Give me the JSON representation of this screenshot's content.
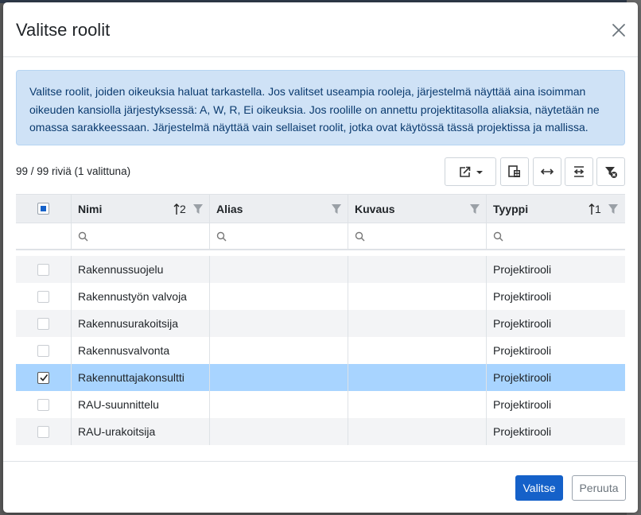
{
  "dialog": {
    "title": "Valitse roolit",
    "info_text": "Valitse roolit, joiden oikeuksia haluat tarkastella. Jos valitset useampia rooleja, järjestelmä näyttää aina isoimman oikeuden kansiolla järjestyksessä: A, W, R, Ei oikeuksia. Jos roolille on annettu projektitasolla aliaksia, näytetään ne omassa sarakkeessaan. Järjestelmä näyttää vain sellaiset roolit, jotka ovat käytössä tässä projektissa ja mallissa."
  },
  "grid": {
    "row_count": "99 / 99 riviä (1 valittuna)",
    "columns": {
      "name": "Nimi",
      "name_sort": "2",
      "alias": "Alias",
      "description": "Kuvaus",
      "type": "Tyyppi",
      "type_sort": "1"
    },
    "rows": [
      {
        "name": "Rakennussuojelu",
        "alias": "",
        "description": "",
        "type": "Projektirooli",
        "selected": false
      },
      {
        "name": "Rakennustyön valvoja",
        "alias": "",
        "description": "",
        "type": "Projektirooli",
        "selected": false
      },
      {
        "name": "Rakennusurakoitsija",
        "alias": "",
        "description": "",
        "type": "Projektirooli",
        "selected": false
      },
      {
        "name": "Rakennusvalvonta",
        "alias": "",
        "description": "",
        "type": "Projektirooli",
        "selected": false
      },
      {
        "name": "Rakennuttajakonsultti",
        "alias": "",
        "description": "",
        "type": "Projektirooli",
        "selected": true
      },
      {
        "name": "RAU-suunnittelu",
        "alias": "",
        "description": "",
        "type": "Projektirooli",
        "selected": false
      },
      {
        "name": "RAU-urakoitsija",
        "alias": "",
        "description": "",
        "type": "Projektirooli",
        "selected": false
      }
    ]
  },
  "footer": {
    "confirm_label": "Valitse",
    "cancel_label": "Peruuta"
  },
  "colors": {
    "primary": "#1561c9",
    "info_bg": "#cfe2f6",
    "selected_row": "#a8d4ff"
  },
  "icons": {
    "close": "close-icon",
    "export": "export-icon",
    "columns": "column-chooser-icon",
    "fit_width": "fit-width-icon",
    "wrap": "wrap-text-icon",
    "clear_filters": "clear-filter-icon"
  }
}
